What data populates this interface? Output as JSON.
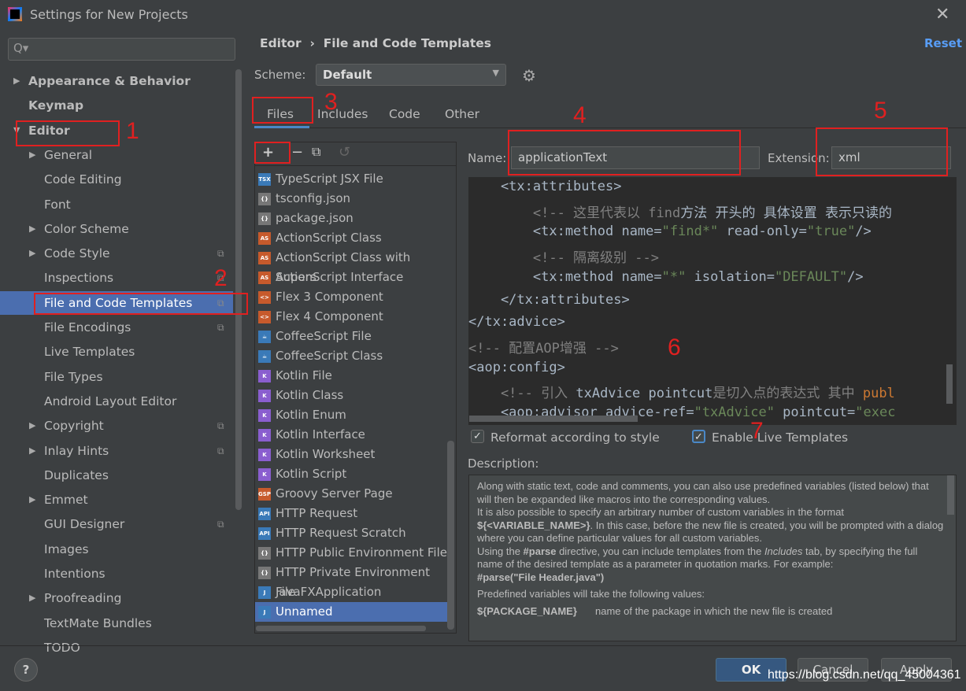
{
  "window": {
    "title": "Settings for New Projects",
    "close_icon": "close-icon"
  },
  "search": {
    "icon": "search-icon",
    "placeholder": "Q▾"
  },
  "sidebar": {
    "items": [
      {
        "label": "Appearance & Behavior",
        "level": 0,
        "expandable": true,
        "expanded": false
      },
      {
        "label": "Keymap",
        "level": 0
      },
      {
        "label": "Editor",
        "level": 0,
        "expandable": true,
        "expanded": true
      },
      {
        "label": "General",
        "level": 1,
        "expandable": true
      },
      {
        "label": "Code Editing",
        "level": 1
      },
      {
        "label": "Font",
        "level": 1
      },
      {
        "label": "Color Scheme",
        "level": 1,
        "expandable": true
      },
      {
        "label": "Code Style",
        "level": 1,
        "expandable": true,
        "copy": true
      },
      {
        "label": "Inspections",
        "level": 1,
        "copy": true
      },
      {
        "label": "File and Code Templates",
        "level": 1,
        "copy": true,
        "selected": true
      },
      {
        "label": "File Encodings",
        "level": 1,
        "copy": true
      },
      {
        "label": "Live Templates",
        "level": 1
      },
      {
        "label": "File Types",
        "level": 1
      },
      {
        "label": "Android Layout Editor",
        "level": 1
      },
      {
        "label": "Copyright",
        "level": 1,
        "expandable": true,
        "copy": true
      },
      {
        "label": "Inlay Hints",
        "level": 1,
        "expandable": true,
        "copy": true
      },
      {
        "label": "Duplicates",
        "level": 1
      },
      {
        "label": "Emmet",
        "level": 1,
        "expandable": true
      },
      {
        "label": "GUI Designer",
        "level": 1,
        "copy": true
      },
      {
        "label": "Images",
        "level": 1
      },
      {
        "label": "Intentions",
        "level": 1
      },
      {
        "label": "Proofreading",
        "level": 1,
        "expandable": true
      },
      {
        "label": "TextMate Bundles",
        "level": 1
      },
      {
        "label": "TODO",
        "level": 1
      }
    ]
  },
  "header": {
    "breadcrumb": [
      "Editor",
      "File and Code Templates"
    ],
    "separator": "›",
    "reset": "Reset"
  },
  "scheme": {
    "label": "Scheme:",
    "value": "Default"
  },
  "tabs": [
    "Files",
    "Includes",
    "Code",
    "Other"
  ],
  "templates": [
    {
      "label": "TypeScript JSX File",
      "icon": "TSX",
      "color": "#3a7ab8"
    },
    {
      "label": "tsconfig.json",
      "icon": "{}",
      "color": "#777"
    },
    {
      "label": "package.json",
      "icon": "{}",
      "color": "#777"
    },
    {
      "label": "ActionScript Class",
      "icon": "AS",
      "color": "#c75a2c"
    },
    {
      "label": "ActionScript Class with Supers",
      "icon": "AS",
      "color": "#c75a2c"
    },
    {
      "label": "ActionScript Interface",
      "icon": "AS",
      "color": "#c75a2c"
    },
    {
      "label": "Flex 3 Component",
      "icon": "<>",
      "color": "#c75a2c"
    },
    {
      "label": "Flex 4 Component",
      "icon": "<>",
      "color": "#c75a2c"
    },
    {
      "label": "CoffeeScript File",
      "icon": "☕",
      "color": "#3a7ab8"
    },
    {
      "label": "CoffeeScript Class",
      "icon": "☕",
      "color": "#3a7ab8"
    },
    {
      "label": "Kotlin File",
      "icon": "K",
      "color": "#8a5ecf"
    },
    {
      "label": "Kotlin Class",
      "icon": "K",
      "color": "#8a5ecf"
    },
    {
      "label": "Kotlin Enum",
      "icon": "K",
      "color": "#8a5ecf"
    },
    {
      "label": "Kotlin Interface",
      "icon": "K",
      "color": "#8a5ecf"
    },
    {
      "label": "Kotlin Worksheet",
      "icon": "K",
      "color": "#8a5ecf"
    },
    {
      "label": "Kotlin Script",
      "icon": "K",
      "color": "#8a5ecf"
    },
    {
      "label": "Groovy Server Page",
      "icon": "GSP",
      "color": "#c75a2c"
    },
    {
      "label": "HTTP Request",
      "icon": "API",
      "color": "#3a7ab8"
    },
    {
      "label": "HTTP Request Scratch",
      "icon": "API",
      "color": "#3a7ab8"
    },
    {
      "label": "HTTP Public Environment File",
      "icon": "{}",
      "color": "#777"
    },
    {
      "label": "HTTP Private Environment File",
      "icon": "{}",
      "color": "#777"
    },
    {
      "label": "JavaFXApplication",
      "icon": "J",
      "color": "#3a7ab8"
    },
    {
      "label": "Unnamed",
      "icon": "J",
      "color": "#3a7ab8",
      "selected": true
    }
  ],
  "form": {
    "name_label": "Name:",
    "name_value": "applicationText",
    "ext_label": "Extension:",
    "ext_value": "xml"
  },
  "code": [
    [
      [
        "    <tx:attributes>",
        ""
      ]
    ],
    [
      [
        "        <!-- 这里代表以 ",
        "cm"
      ],
      [
        "find",
        "cm"
      ],
      [
        "方法 开头的 具体设置 表示只读的",
        ""
      ]
    ],
    [
      [
        "        <tx:method name=",
        ""
      ],
      [
        "\"find*\"",
        "st"
      ],
      [
        " read-only=",
        ""
      ],
      [
        "\"true\"",
        "st"
      ],
      [
        "/>",
        ""
      ]
    ],
    [
      [
        "        <!-- 隔离级别 -->",
        "cm"
      ]
    ],
    [
      [
        "        <tx:method name=",
        ""
      ],
      [
        "\"*\"",
        "st"
      ],
      [
        " isolation=",
        ""
      ],
      [
        "\"DEFAULT\"",
        "st"
      ],
      [
        "/>",
        ""
      ]
    ],
    [
      [
        "    </tx:attributes>",
        ""
      ]
    ],
    [
      [
        "</tx:advice>",
        ""
      ]
    ],
    [
      [
        "<!-- 配置AOP增强 -->",
        "cm"
      ]
    ],
    [
      [
        "<aop:config>",
        ""
      ]
    ],
    [
      [
        "    <!-- 引入 ",
        "cm"
      ],
      [
        "txAdvice pointcut",
        ""
      ],
      [
        "是切入点的表达式 其中 ",
        "cm"
      ],
      [
        "publ",
        "kw"
      ]
    ],
    [
      [
        "    <aop:advisor advice-ref=",
        ""
      ],
      [
        "\"txAdvice\"",
        "st"
      ],
      [
        " pointcut=",
        ""
      ],
      [
        "\"exec",
        "st"
      ]
    ]
  ],
  "options": {
    "reformat": {
      "label": "Reformat according to style",
      "checked": true
    },
    "live": {
      "label": "Enable Live Templates",
      "checked": true
    }
  },
  "description": {
    "label": "Description:",
    "p1": "Along with static text, code and comments, you can also use predefined variables (listed below) that will then be expanded like macros into the corresponding values.",
    "p2a": "It is also possible to specify an arbitrary number of custom variables in the format ",
    "p2b": "${<VARIABLE_NAME>}",
    "p2c": ". In this case, before the new file is created, you will be prompted with a dialog where you can define particular values for all custom variables.",
    "p3a": "Using the ",
    "p3b": "#parse",
    "p3c": " directive, you can include templates from the ",
    "p3d": "Includes",
    "p3e": " tab, by specifying the full name of the desired template as a parameter in quotation marks. For example:",
    "p3f": "#parse(\"File Header.java\")",
    "p4": "Predefined variables will take the following values:",
    "p5a": "${PACKAGE_NAME}",
    "p5b": "name of the package in which the new file is created"
  },
  "buttons": {
    "help": "?",
    "ok": "OK",
    "cancel": "Cancel",
    "apply": "Apply"
  },
  "annotations": [
    "1",
    "2",
    "3",
    "4",
    "5",
    "6",
    "7"
  ],
  "watermark": "https://blog.csdn.net/qq_45004361",
  "colors": {
    "accent": "#4b6eaf",
    "annotation": "#e02020",
    "editor_bg": "#2b2b2b",
    "link": "#589df6"
  }
}
